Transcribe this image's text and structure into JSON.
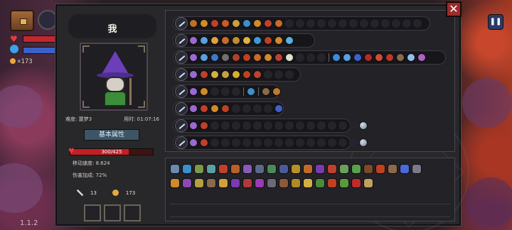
{
  "hud": {
    "gold": "×173",
    "version": "1.1.2",
    "pause_icon": "pause-icon"
  },
  "character": {
    "name": "我",
    "difficulty": "难度: 噩梦3",
    "time": "用时: 01:07:16",
    "attr_title": "基本属性",
    "hp_text": "300/425",
    "hp_fraction": 0.706,
    "move_speed": "移动速度: 8.624",
    "damage_bonus": "伤害加成: 72%",
    "keys": "13",
    "coins": "173"
  },
  "colors": {
    "panel": "#28272a",
    "accent_hp": "#c21f24",
    "close": "#9c2b2b",
    "pause": "#2b3a66"
  },
  "wands": [
    {
      "spells": [
        "#b8702a",
        "#d08a2a",
        "#c0402e",
        "#c95a2a",
        "#caa040",
        "#3d8fc8",
        "#d08a2a",
        "#c0402e",
        "#c96a2a"
      ],
      "empty": 13
    },
    {
      "spells": [
        "#9a6ad0",
        "#5aa0e0",
        "#e0a040",
        "#c76a2a",
        "#c0902e",
        "#e0b040",
        "#3d9ad8",
        "#c04020",
        "#d08a2a",
        "#5ab0e0"
      ],
      "empty": 0
    },
    {
      "spells": [
        "#9a6ad0",
        "#5aa0e0",
        "#3f78c8",
        "#707070",
        "#b0402e",
        "#c04020",
        "#c76a2a",
        "#d08a2a",
        "#c0402e",
        "#e0e0d0"
      ],
      "empty": 3,
      "extra": [
        "#3f8ad8",
        "#5aa0e0",
        "#4060c8",
        "#b02a2a",
        "#d04a3a",
        "#b83a2a",
        "#8a6a4a",
        "#8fc0e8",
        "#b060c8"
      ]
    },
    {
      "spells": [
        "#9a6ad0",
        "#c0402e",
        "#d4b040",
        "#c8a040",
        "#d8b030",
        "#c04020",
        "#c0402e"
      ],
      "empty": 3
    },
    {
      "spells": [
        "#9a6ad0",
        "#d08a2a"
      ],
      "empty": 3,
      "extra": [
        "#3d8fc8"
      ],
      "extra2": [
        "#8a6a4a",
        "#c07a2a"
      ]
    },
    {
      "spells": [
        "#9a6ad0",
        "#c0402e",
        "#d08a2a",
        "#c04020"
      ],
      "empty": 4,
      "tail": [
        "#4060c8"
      ]
    },
    {
      "spells": [
        "#9a6ad0",
        "#c0402e"
      ],
      "empty": 14,
      "pearl": true
    },
    {
      "spells": [
        "#9a6ad0",
        "#c0402e"
      ],
      "empty": 14,
      "pearl": true
    }
  ],
  "inventory": [
    [
      "#6a8ab0",
      "#3d8fc8",
      "#7a9a4a",
      "#5aa0a0",
      "#c0402e",
      "#b8602a",
      "#8a5ab8",
      "#5a6a8a",
      "#4a8a5a",
      "#4a5a9a",
      "#b8902a",
      "#c06a2a",
      "#7a3ab0",
      "#c0402e",
      "#6aa05a",
      "#5aa04a",
      "#7a4a2a",
      "#c04020",
      "#8a6a4a",
      "#4a6ad8",
      "#7a7a8a"
    ],
    [
      "#d08a2a",
      "#8a4ab0",
      "#b8a040",
      "#8a6a4a",
      "#d0a040",
      "#7a3ab0",
      "#b03a3a",
      "#9a3ab8",
      "#6a6a7a",
      "#8a5a3a",
      "#b08a2a",
      "#d0b040",
      "#4a8a3a",
      "#c04020",
      "#5a9a3a",
      "#c02a2a",
      "#c0a060"
    ]
  ]
}
